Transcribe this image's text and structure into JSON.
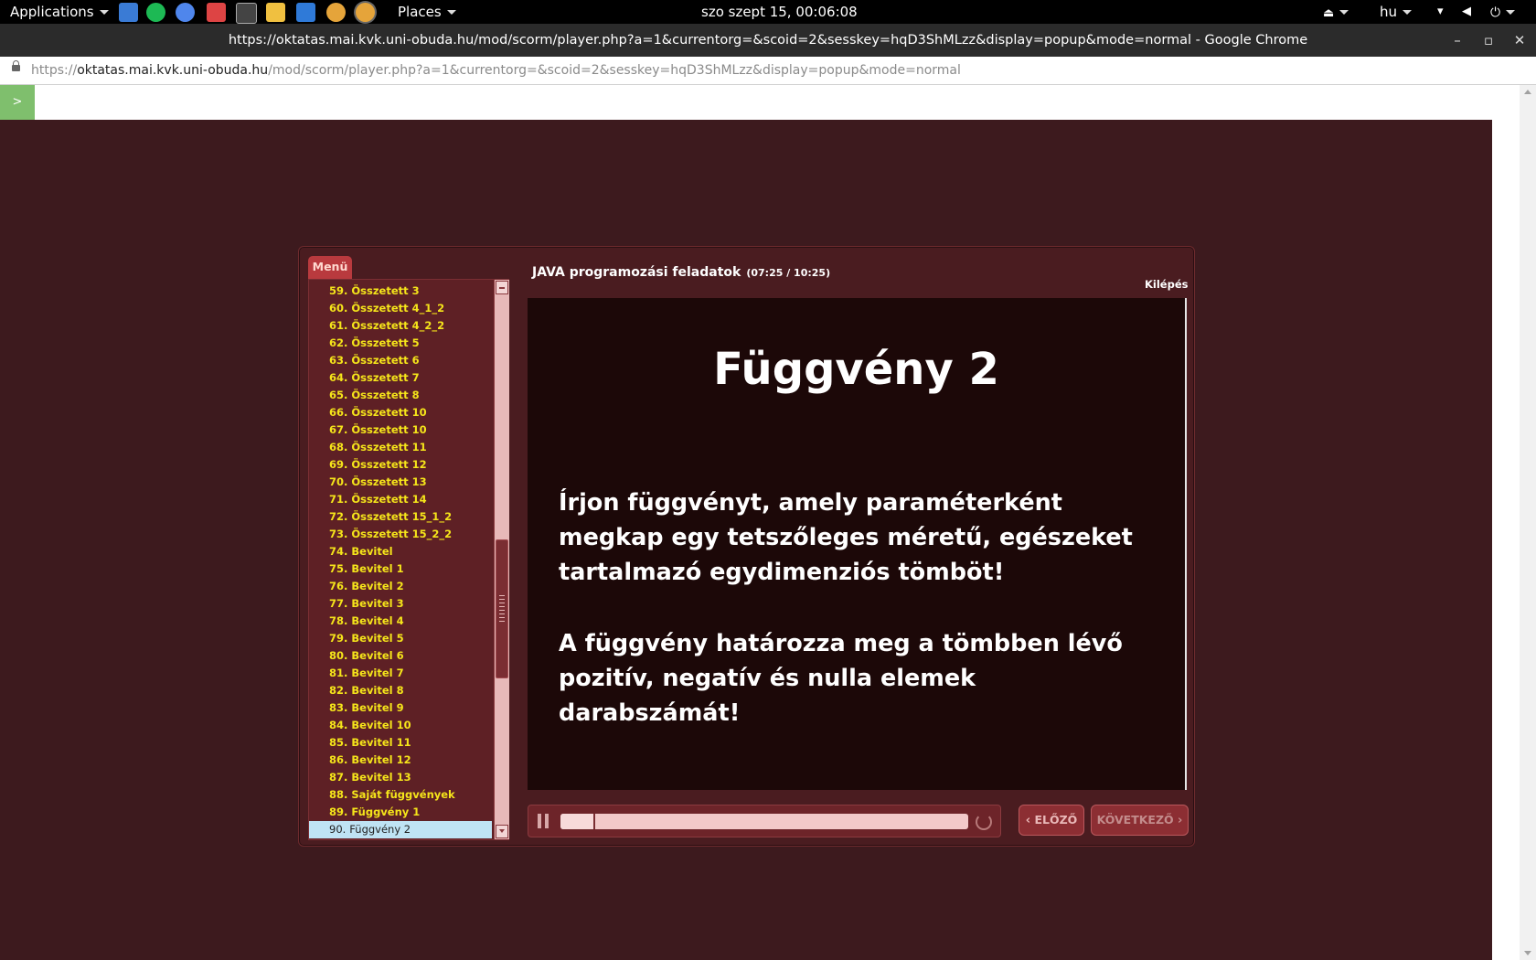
{
  "system_bar": {
    "applications_label": "Applications",
    "places_label": "Places",
    "clock": "szo szept 15, 00:06:08",
    "keyboard_layout": "hu"
  },
  "browser": {
    "window_title": "https://oktatas.mai.kvk.uni-obuda.hu/mod/scorm/player.php?a=1&currentorg=&scoid=2&sesskey=hqD3ShMLzz&display=popup&mode=normal - Google Chrome",
    "url_scheme": "https://",
    "url_host": "oktatas.mai.kvk.uni-obuda.hu",
    "url_path": "/mod/scorm/player.php?a=1&currentorg=&scoid=2&sesskey=hqD3ShMLzz&display=popup&mode=normal",
    "minimize_symbol": "–",
    "maximize_symbol": "▫",
    "close_symbol": "✕"
  },
  "page": {
    "toggle_label": ">"
  },
  "player": {
    "menu_tab": "Menü",
    "course_title": "JAVA programozási feladatok",
    "course_time": "(07:25 / 10:25)",
    "exit_label": "Kilépés",
    "menu_items": [
      {
        "num": "59.",
        "label": "Összetett 3"
      },
      {
        "num": "60.",
        "label": "Összetett 4_1_2"
      },
      {
        "num": "61.",
        "label": "Összetett 4_2_2"
      },
      {
        "num": "62.",
        "label": "Összetett 5"
      },
      {
        "num": "63.",
        "label": "Összetett 6"
      },
      {
        "num": "64.",
        "label": "Összetett 7"
      },
      {
        "num": "65.",
        "label": "Összetett 8"
      },
      {
        "num": "66.",
        "label": "Összetett 10"
      },
      {
        "num": "67.",
        "label": "Összetett 10"
      },
      {
        "num": "68.",
        "label": "Összetett 11"
      },
      {
        "num": "69.",
        "label": "Összetett 12"
      },
      {
        "num": "70.",
        "label": "Összetett 13"
      },
      {
        "num": "71.",
        "label": "Összetett 14"
      },
      {
        "num": "72.",
        "label": "Összetett 15_1_2"
      },
      {
        "num": "73.",
        "label": "Összetett 15_2_2"
      },
      {
        "num": "74.",
        "label": "Bevitel"
      },
      {
        "num": "75.",
        "label": "Bevitel 1"
      },
      {
        "num": "76.",
        "label": "Bevitel 2"
      },
      {
        "num": "77.",
        "label": "Bevitel 3"
      },
      {
        "num": "78.",
        "label": "Bevitel 4"
      },
      {
        "num": "79.",
        "label": "Bevitel 5"
      },
      {
        "num": "80.",
        "label": "Bevitel 6"
      },
      {
        "num": "81.",
        "label": "Bevitel 7"
      },
      {
        "num": "82.",
        "label": "Bevitel 8"
      },
      {
        "num": "83.",
        "label": "Bevitel 9"
      },
      {
        "num": "84.",
        "label": "Bevitel 10"
      },
      {
        "num": "85.",
        "label": "Bevitel 11"
      },
      {
        "num": "86.",
        "label": "Bevitel 12"
      },
      {
        "num": "87.",
        "label": "Bevitel 13"
      },
      {
        "num": "88.",
        "label": "Saját függvények"
      },
      {
        "num": "89.",
        "label": "Függvény 1"
      },
      {
        "num": "90.",
        "label": "Függvény 2",
        "active": true
      }
    ],
    "slide": {
      "title": "Függvény 2",
      "paragraph1": "Írjon függvényt, amely paraméterként megkap egy tetszőleges méretű, egészeket tartalmazó egydimenziós tömböt!",
      "paragraph2": "A függvény határozza meg a tömbben lévő pozitív, negatív és nulla elemek darabszámát!"
    },
    "progress_fraction": 0.08,
    "prev_label": "ELŐZŐ",
    "next_label": "KÖVETKEZŐ"
  },
  "colors": {
    "page_background": "#3d1a1e",
    "menu_item_text": "#f5e51a",
    "active_item_bg": "#bfe3f4",
    "accent_tab": "#b93a3e"
  }
}
